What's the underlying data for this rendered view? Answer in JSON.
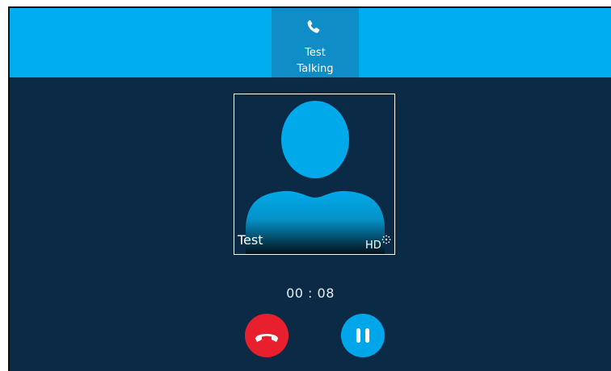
{
  "call_tab": {
    "icon": "phone-icon",
    "name": "Test",
    "status": "Talking"
  },
  "contact": {
    "icon": "person-silhouette-icon",
    "name": "Test",
    "hd_label": "HD"
  },
  "call_timer": "00 : 08",
  "controls": {
    "end_call": {
      "icon": "hang-up-icon",
      "color": "#e81f2d"
    },
    "hold": {
      "icon": "pause-icon",
      "color": "#00a6ea"
    }
  },
  "colors": {
    "background": "#0b2a45",
    "top_bar": "#00adef",
    "active_tab": "#0f8dc7"
  }
}
